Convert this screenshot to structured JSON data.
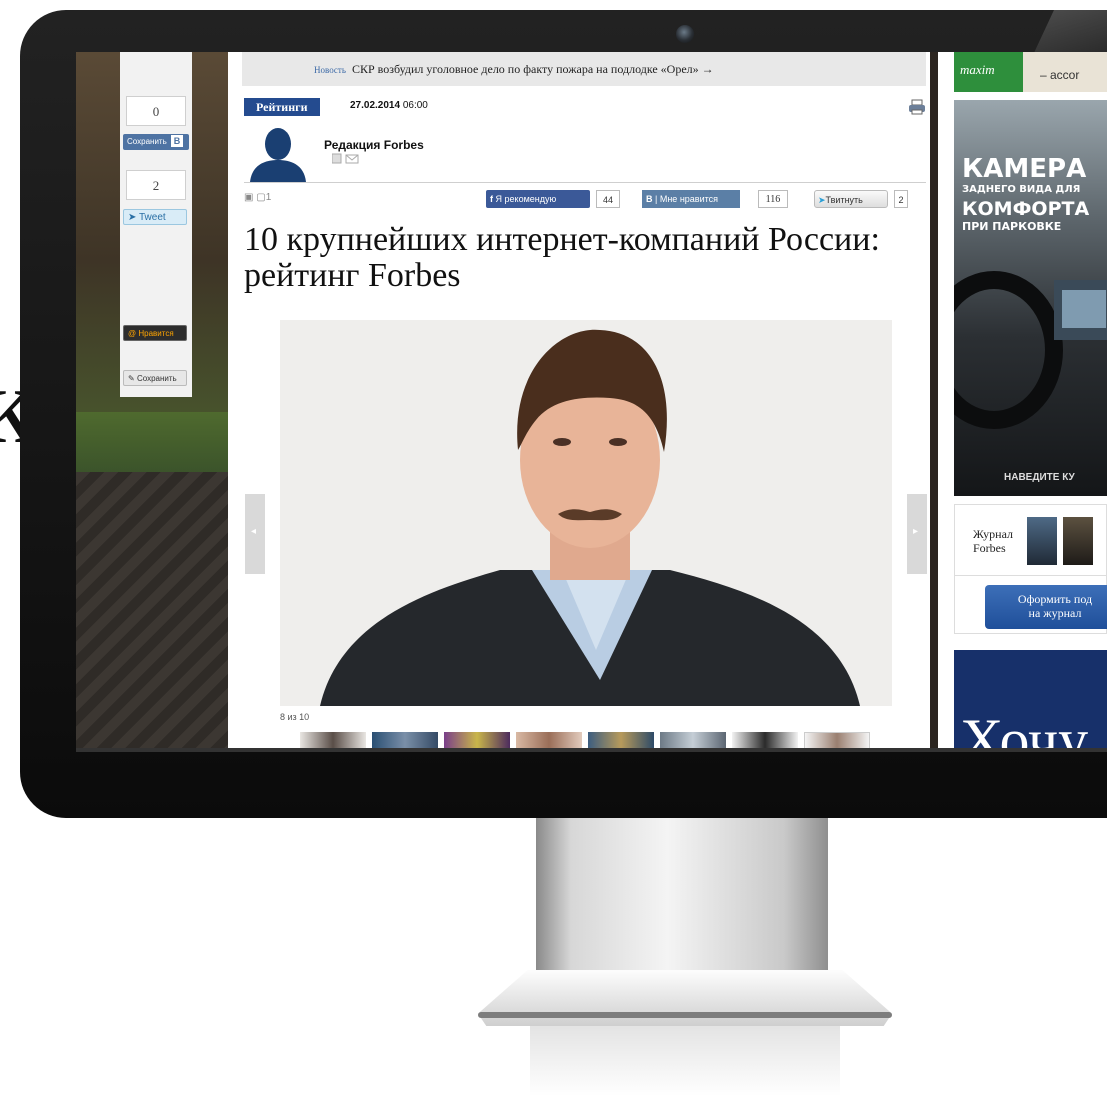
{
  "stray_glyph": "к",
  "share_column": {
    "vk_count": "0",
    "vk_save_label": "Сохранить",
    "vk_letter": "В",
    "tweet_count": "2",
    "tweet_label": "Tweet",
    "ok_like_label": "Нравится",
    "lj_save_label": "Сохранить"
  },
  "news_ticker": {
    "label": "Новость",
    "text": "СКР возбудил уголовное дело по факту пожара на подлодке «Орел» →"
  },
  "article": {
    "rubric": "Рейтинги",
    "date_bold": "27.02.2014",
    "time": "06:00",
    "author": "Редакция Forbes",
    "comments_count": "1",
    "facebook_label": "Я рекомендую",
    "facebook_count": "44",
    "vk_letter": "В",
    "vk_like_label": "Мне нравится",
    "vk_count": "116",
    "twitter_label": "Твитнуть",
    "twitter_count": "2",
    "headline": "10 крупнейших интернет-компаний России: рейтинг Forbes",
    "slide_counter": "8 из 10"
  },
  "sidebar": {
    "ad_top_left": "maxim",
    "ad_top_right": "– accor",
    "ad_line1": "КАМЕРА",
    "ad_line2": "ЗАДНЕГО ВИДА ДЛЯ",
    "ad_line3": "КОМФОРТА",
    "ad_line4": "ПРИ ПАРКОВКЕ",
    "ad_footer": "НАВЕДИТЕ КУ",
    "magazine_label_1": "Журнал",
    "magazine_label_2": "Forbes",
    "subscribe_line1": "Оформить под",
    "subscribe_line2": "на журнал",
    "bottom_ad_text": "Хочу"
  },
  "colors": {
    "rubric_bg": "#244b8f",
    "facebook": "#3b5998",
    "vk": "#5b7fa6",
    "subscribe": "#2a5ca8"
  }
}
